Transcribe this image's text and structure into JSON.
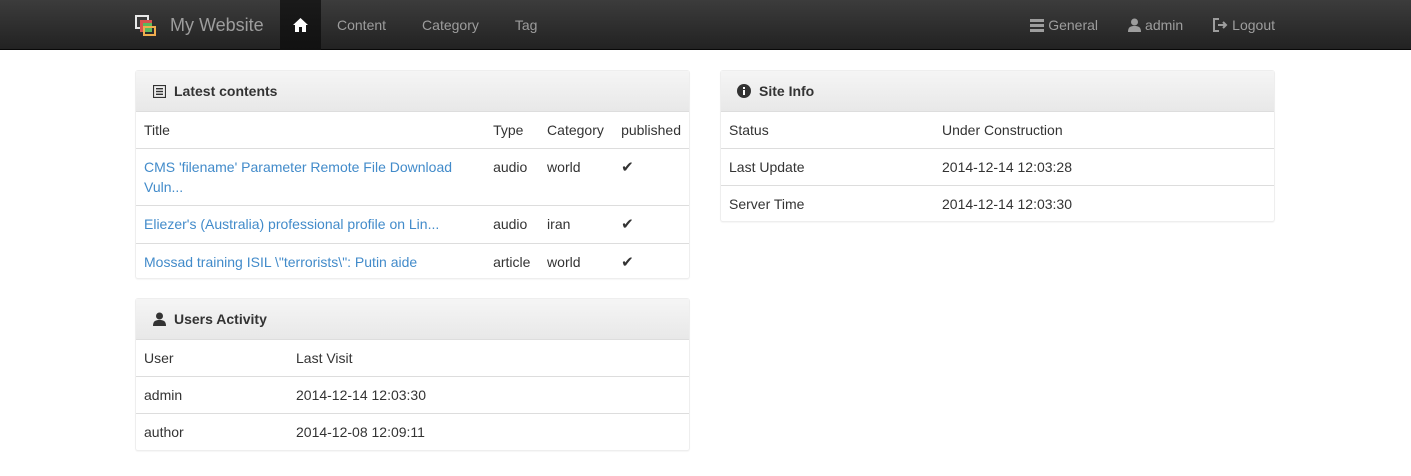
{
  "navbar": {
    "brand": "My Website",
    "left_items": [
      {
        "label": "",
        "icon": "home-icon",
        "active": true
      },
      {
        "label": "Content"
      },
      {
        "label": "Category"
      },
      {
        "label": "Tag"
      }
    ],
    "right_items": [
      {
        "label": "General",
        "icon": "list-icon"
      },
      {
        "label": "admin",
        "icon": "user-icon"
      },
      {
        "label": "Logout",
        "icon": "logout-icon"
      }
    ]
  },
  "latest_contents": {
    "title": "Latest contents",
    "icon": "list-alt-icon",
    "headers": [
      "Title",
      "Type",
      "Category",
      "published"
    ],
    "rows": [
      {
        "title": "CMS 'filename' Parameter Remote File Download Vuln...",
        "type": "audio",
        "category": "world",
        "published": "✔"
      },
      {
        "title": "Eliezer's (Australia) professional profile on Lin...",
        "type": "audio",
        "category": "iran",
        "published": "✔"
      },
      {
        "title": "Mossad training ISIL \\\"terrorists\\\": Putin aide",
        "type": "article",
        "category": "world",
        "published": "✔"
      }
    ]
  },
  "users_activity": {
    "title": "Users Activity",
    "icon": "user-icon",
    "headers": [
      "User",
      "Last Visit"
    ],
    "rows": [
      {
        "user": "admin",
        "last_visit": "2014-12-14 12:03:30"
      },
      {
        "user": "author",
        "last_visit": "2014-12-08 12:09:11"
      }
    ]
  },
  "site_info": {
    "title": "Site Info",
    "icon": "info-icon",
    "rows": [
      {
        "label": "Status",
        "value": "Under Construction"
      },
      {
        "label": "Last Update",
        "value": "2014-12-14 12:03:28"
      },
      {
        "label": "Server Time",
        "value": "2014-12-14 12:03:30"
      }
    ]
  },
  "colors": {
    "link": "#428bca",
    "navbar_text": "#9d9d9d",
    "navbar_bg": "#222222"
  }
}
